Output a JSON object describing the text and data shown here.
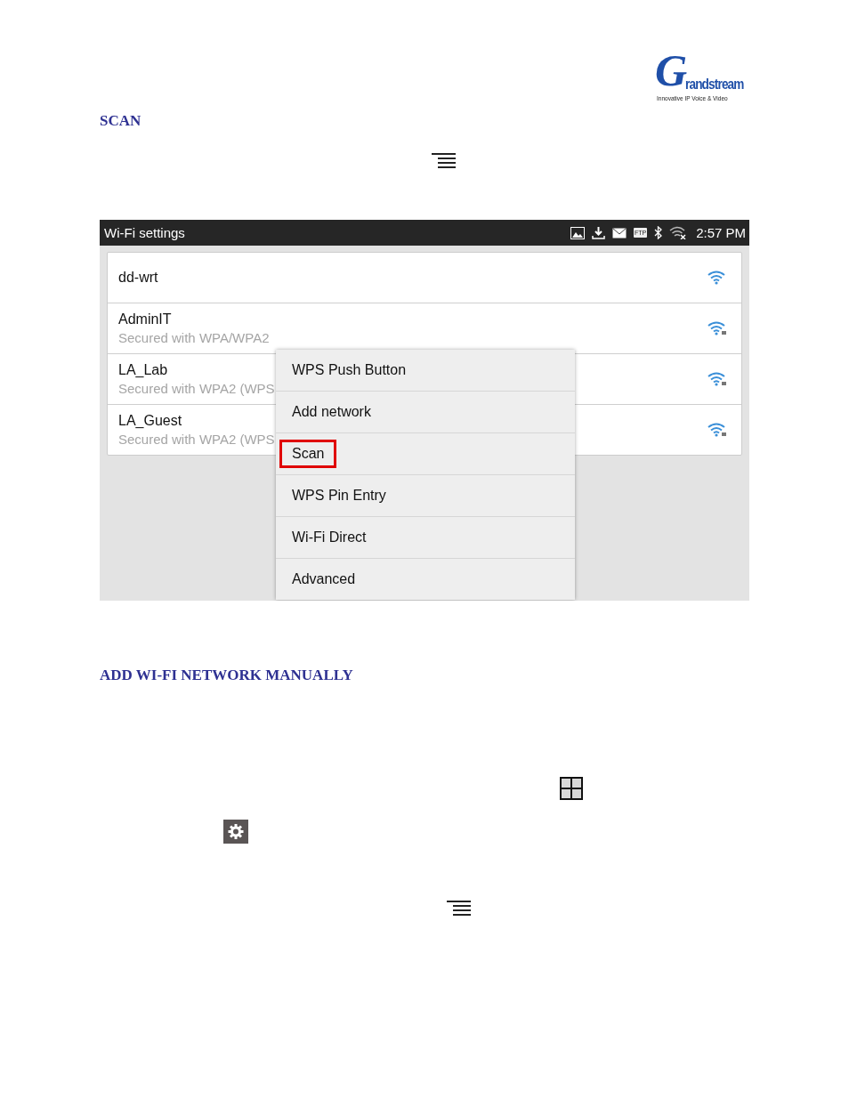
{
  "logo": {
    "initial": "G",
    "wordmark": "randstream",
    "tagline": "Innovative IP Voice & Video"
  },
  "sections": [
    {
      "heading": "SCAN"
    },
    {
      "heading": "ADD WI-FI NETWORK MANUALLY"
    }
  ],
  "screen": {
    "title": "Wi-Fi settings",
    "status_badge": "FTP",
    "time": "2:57 PM",
    "networks": [
      {
        "name": "dd-wrt",
        "locked": false
      },
      {
        "name": "AdminIT",
        "security": "Secured with WPA/WPA2",
        "locked": true
      },
      {
        "name": "LA_Lab",
        "security": "Secured with WPA2 (WPS",
        "locked": true
      },
      {
        "name": "LA_Guest",
        "security": "Secured with WPA2 (WPS",
        "locked": true
      }
    ],
    "menu": [
      {
        "label": "WPS Push Button",
        "outlined": false
      },
      {
        "label": "Add network",
        "outlined": false
      },
      {
        "label": "Scan",
        "outlined": true
      },
      {
        "label": "WPS Pin Entry",
        "outlined": false
      },
      {
        "label": "Wi-Fi Direct",
        "outlined": false
      },
      {
        "label": "Advanced",
        "outlined": false
      }
    ]
  }
}
